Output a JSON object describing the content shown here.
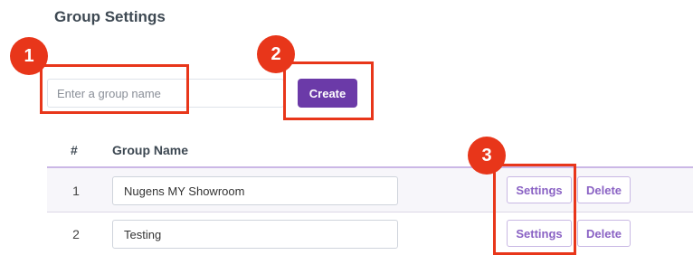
{
  "page": {
    "title": "Group Settings"
  },
  "create_form": {
    "input_placeholder": "Enter a group name",
    "input_value": "",
    "create_label": "Create"
  },
  "table": {
    "headers": [
      "#",
      "Group Name"
    ],
    "rows": [
      {
        "number": "1",
        "group_name": "Nugens MY Showroom",
        "settings_label": "Settings",
        "delete_label": "Delete"
      },
      {
        "number": "2",
        "group_name": "Testing",
        "settings_label": "Settings",
        "delete_label": "Delete"
      }
    ]
  },
  "annotations": {
    "markers": [
      "1",
      "2",
      "3"
    ],
    "marker_color": "#e8361a"
  },
  "colors": {
    "primary": "#6b3aa8",
    "outline_button_text": "#8a62c4"
  }
}
